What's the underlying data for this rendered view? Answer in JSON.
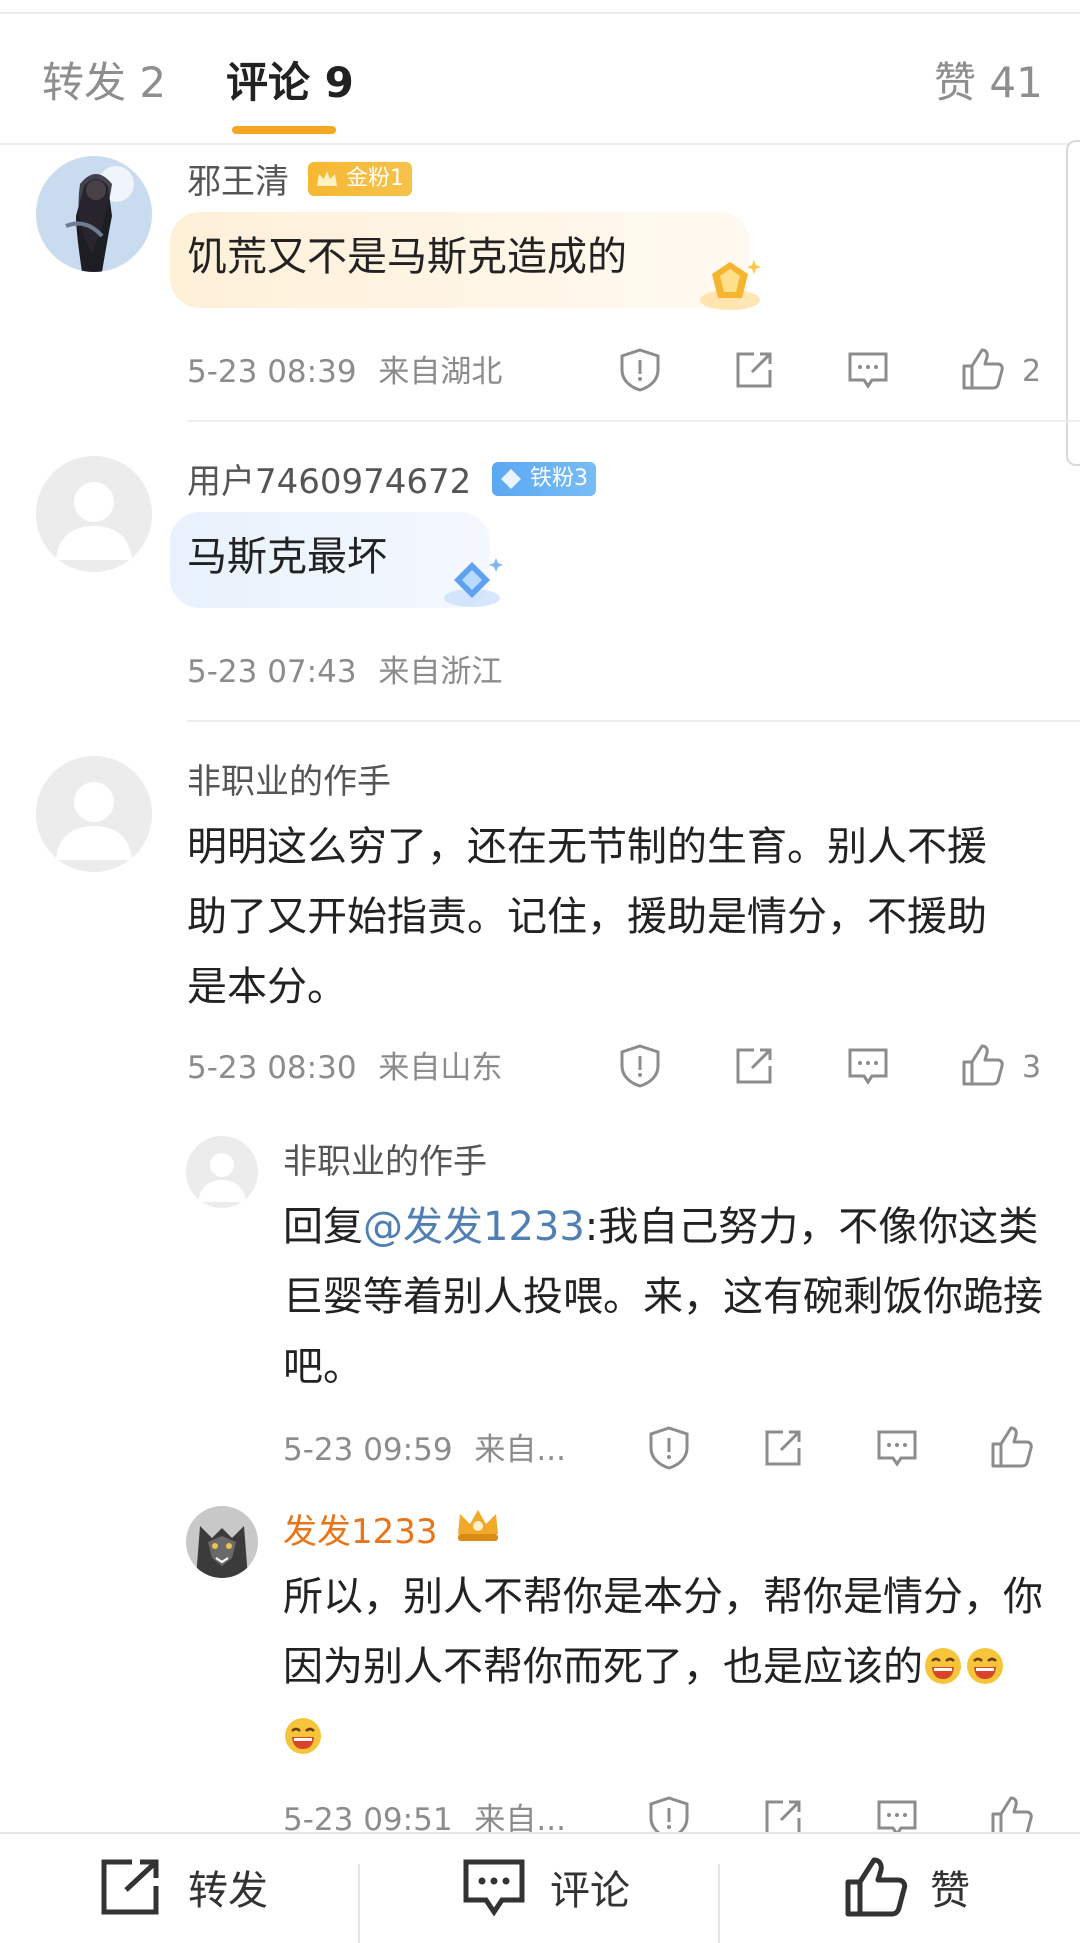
{
  "tabs": {
    "repost": "转发 2",
    "comments": "评论 9",
    "likes": "赞 41"
  },
  "comments": [
    {
      "username": "邪王清",
      "badge": "金粉1",
      "text": "饥荒又不是马斯克造成的",
      "time": "5-23 08:39",
      "location": "来自湖北",
      "like_count": "2"
    },
    {
      "username": "用户7460974672",
      "badge": "铁粉3",
      "text": "马斯克最坏",
      "time": "5-23 07:43",
      "location": "来自浙江"
    },
    {
      "username": "非职业的作手",
      "text": "明明这么穷了，还在无节制的生育。别人不援助了又开始指责。记住，援助是情分，不援助是本分。",
      "time": "5-23 08:30",
      "location": "来自山东",
      "like_count": "3"
    }
  ],
  "replies": [
    {
      "username": "非职业的作手",
      "reply_prefix": "回复",
      "mention": "@发发1233",
      "text": ":我自己努力，不像你这类巨婴等着别人投喂。来，这有碗剩饭你跪接吧。",
      "time": "5-23 09:59",
      "location": "来自..."
    },
    {
      "username": "发发1233",
      "text": "所以，别人不帮你是本分，帮你是情分，你因为别人不帮你而死了，也是应该的",
      "time": "5-23 09:51",
      "location": "来自..."
    }
  ],
  "bottom_bar": {
    "repost": "转发",
    "comment": "评论",
    "like": "赞"
  },
  "colors": {
    "accent": "#f5a623",
    "mention": "#4f7fb3",
    "vip_name": "#e8751a"
  }
}
